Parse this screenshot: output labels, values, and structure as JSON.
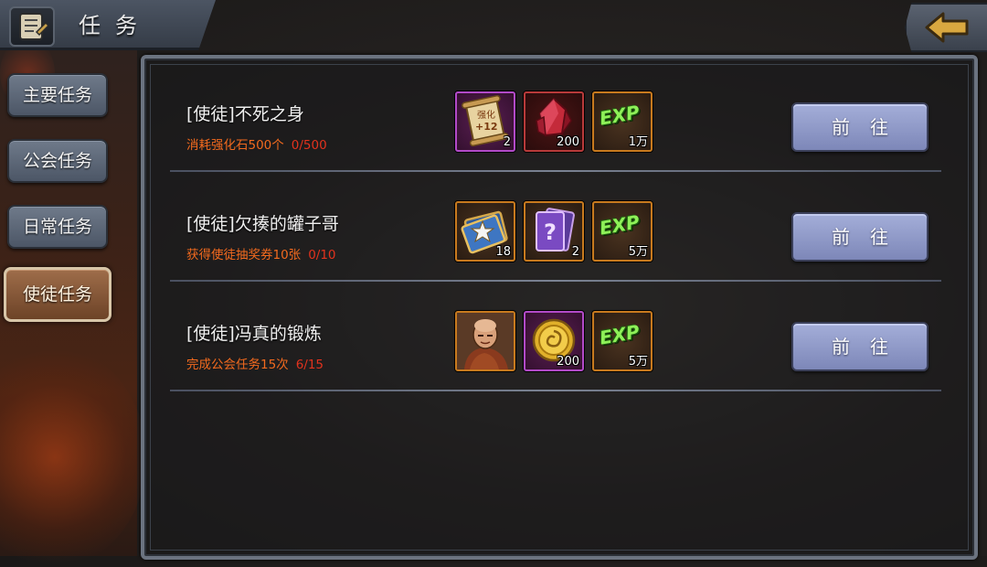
{
  "header": {
    "title": "任务"
  },
  "tabs": [
    {
      "label": "主要任务",
      "active": false
    },
    {
      "label": "公会任务",
      "active": false
    },
    {
      "label": "日常任务",
      "active": false
    },
    {
      "label": "使徒任务",
      "active": true
    }
  ],
  "tasks": [
    {
      "name": "[使徒]不死之身",
      "condition": "消耗强化石500个",
      "progress": "0/500",
      "button": "前往",
      "rewards": [
        {
          "icon": "enhance-scroll-icon",
          "label": "强化",
          "sub": "+12",
          "count": "2",
          "rarity": "purple"
        },
        {
          "icon": "red-crystal-icon",
          "count": "200",
          "rarity": "red"
        },
        {
          "icon": "exp-icon",
          "label": "EXP",
          "count": "1万",
          "rarity": "orange"
        }
      ]
    },
    {
      "name": "[使徒]欠揍的罐子哥",
      "condition": "获得使徒抽奖券10张",
      "progress": "0/10",
      "button": "前往",
      "rewards": [
        {
          "icon": "star-card-icon",
          "count": "18",
          "rarity": "orange"
        },
        {
          "icon": "mystery-card-icon",
          "count": "2",
          "rarity": "orange"
        },
        {
          "icon": "exp-icon",
          "label": "EXP",
          "count": "5万",
          "rarity": "orange"
        }
      ]
    },
    {
      "name": "[使徒]冯真的锻炼",
      "condition": "完成公会任务15次",
      "progress": "6/15",
      "button": "前往",
      "rewards": [
        {
          "icon": "monk-hero-icon",
          "count": "",
          "rarity": "orange"
        },
        {
          "icon": "gold-coin-icon",
          "count": "200",
          "rarity": "purple"
        },
        {
          "icon": "exp-icon",
          "label": "EXP",
          "count": "5万",
          "rarity": "orange"
        }
      ]
    }
  ],
  "colors": {
    "condition": "#f26a1e",
    "progress": "#e2321d",
    "goto_button": "#9aa4d2",
    "active_tab": "#8a5a3a"
  }
}
